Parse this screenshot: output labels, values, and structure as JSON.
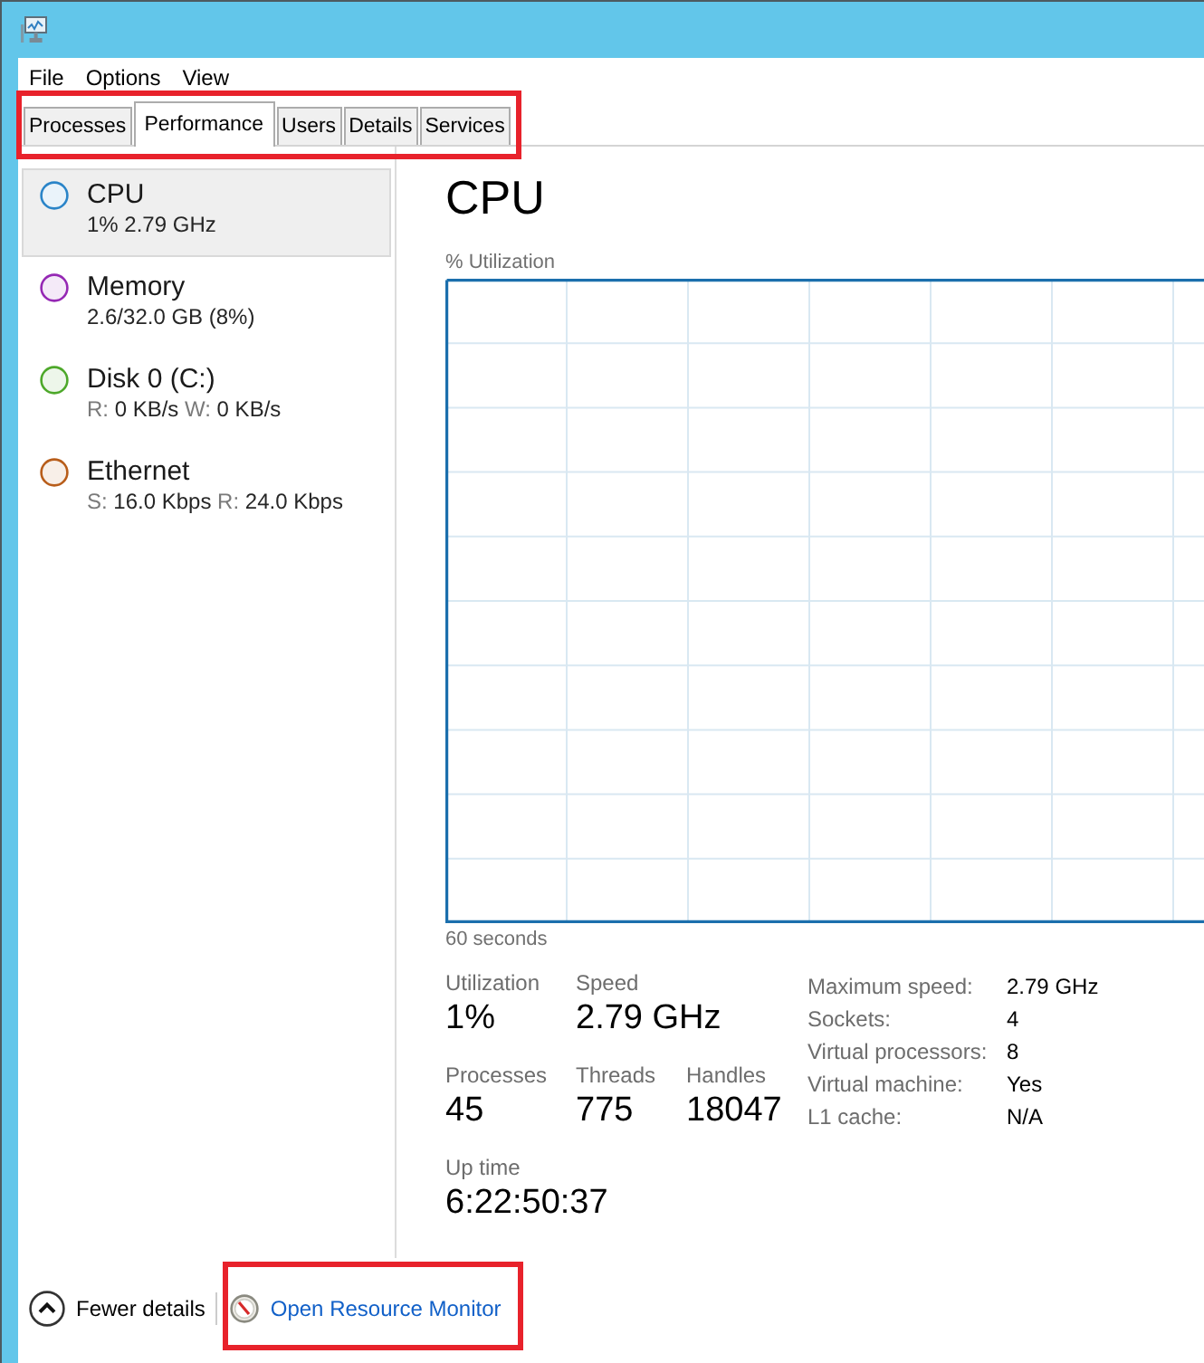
{
  "menu": [
    "File",
    "Options",
    "View"
  ],
  "tab_strip": {
    "highlighted": true,
    "tabs": [
      {
        "label": "Processes",
        "selected": false
      },
      {
        "label": "Performance",
        "selected": true
      },
      {
        "label": "Users",
        "selected": false
      },
      {
        "label": "Details",
        "selected": false
      },
      {
        "label": "Services",
        "selected": false
      }
    ]
  },
  "sidebar": {
    "items": [
      {
        "name": "CPU",
        "selected": true,
        "color": "#2a84c8",
        "detail": [
          {
            "kind": "value",
            "text": "1%"
          },
          {
            "kind": "value",
            "text": "2.79 GHz"
          }
        ]
      },
      {
        "name": "Memory",
        "selected": false,
        "color": "#9528b4",
        "detail": [
          {
            "kind": "value",
            "text": "2.6/32.0 GB (8%)"
          }
        ]
      },
      {
        "name": "Disk 0 (C:)",
        "selected": false,
        "color": "#4da82a",
        "detail": [
          {
            "kind": "label",
            "text": "R:"
          },
          {
            "kind": "value",
            "text": "0 KB/s"
          },
          {
            "kind": "label",
            "text": "W:"
          },
          {
            "kind": "value",
            "text": "0 KB/s"
          }
        ]
      },
      {
        "name": "Ethernet",
        "selected": false,
        "color": "#b85d1a",
        "detail": [
          {
            "kind": "label",
            "text": "S:"
          },
          {
            "kind": "value",
            "text": "16.0 Kbps"
          },
          {
            "kind": "label",
            "text": "R:"
          },
          {
            "kind": "value",
            "text": "24.0 Kbps"
          }
        ]
      }
    ]
  },
  "detail_panel": {
    "title": "CPU",
    "graph_caption": "% Utilization",
    "graph_span": "60 seconds",
    "stat_rows": [
      [
        {
          "label": "Utilization",
          "value": "1%"
        },
        {
          "label": "Speed",
          "value": "2.79 GHz"
        }
      ],
      [
        {
          "label": "Processes",
          "value": "45"
        },
        {
          "label": "Threads",
          "value": "775"
        },
        {
          "label": "Handles",
          "value": "18047"
        }
      ],
      [
        {
          "label": "Up time",
          "value": "6:22:50:37"
        }
      ]
    ],
    "properties": [
      {
        "label": "Maximum speed:",
        "value": "2.79 GHz"
      },
      {
        "label": "Sockets:",
        "value": "4"
      },
      {
        "label": "Virtual processors:",
        "value": "8"
      },
      {
        "label": "Virtual machine:",
        "value": "Yes"
      },
      {
        "label": "L1 cache:",
        "value": "N/A"
      }
    ]
  },
  "footer": {
    "fewer_details": {
      "label": "Fewer details"
    },
    "resource_monitor_link": {
      "label": "Open Resource Monitor",
      "highlighted": true
    }
  }
}
